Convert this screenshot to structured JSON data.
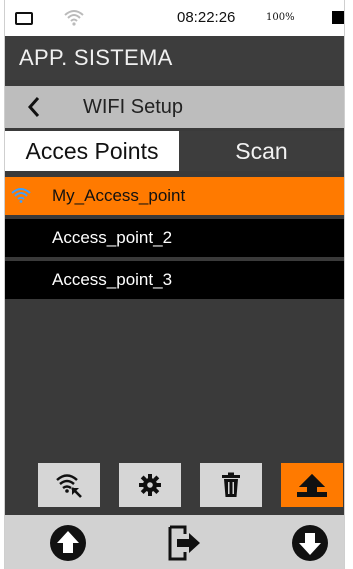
{
  "status_bar": {
    "time": "08:22:26",
    "battery_percent": "100%",
    "icons": [
      "battery-outline-icon",
      "wifi-icon",
      "battery-block-icon"
    ]
  },
  "app": {
    "title": "APP. SISTEMA"
  },
  "sub_header": {
    "back_icon": "chevron-left-icon",
    "title": "WIFI Setup"
  },
  "tabs": [
    {
      "label": "Acces Points",
      "active": true
    },
    {
      "label": "Scan",
      "active": false
    }
  ],
  "access_points": [
    {
      "name": "My_Access_point",
      "selected": true,
      "icon": "wifi-icon"
    },
    {
      "name": "Access_point_2",
      "selected": false
    },
    {
      "name": "Access_point_3",
      "selected": false
    }
  ],
  "toolbar": {
    "buttons": [
      {
        "icon": "wifi-connect-icon"
      },
      {
        "icon": "gear-icon"
      },
      {
        "icon": "trash-icon"
      },
      {
        "icon": "upload-icon"
      }
    ]
  },
  "bottom_nav": {
    "buttons": [
      {
        "icon": "arrow-up-circle-icon"
      },
      {
        "icon": "exit-icon"
      },
      {
        "icon": "arrow-down-circle-icon"
      }
    ]
  },
  "colors": {
    "accent": "#ff7a00",
    "panel": "#3a3a3a",
    "list_item": "#000000",
    "subheader": "#bdbdbd",
    "toolbar_button": "#d6d6d6"
  }
}
